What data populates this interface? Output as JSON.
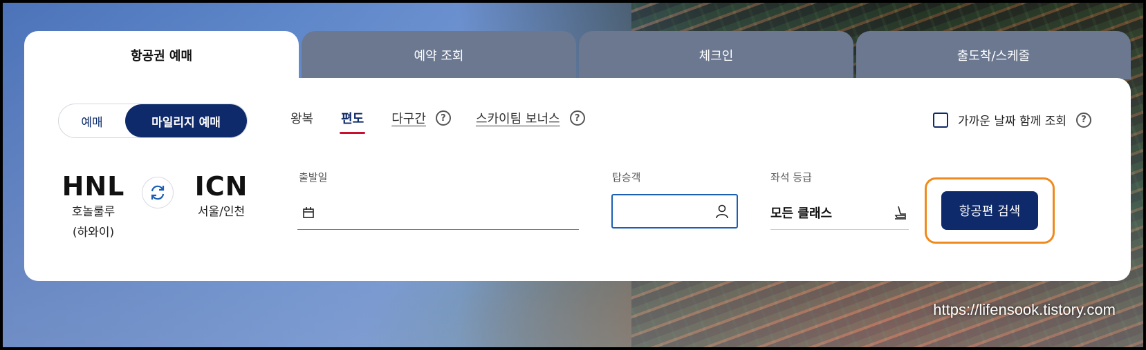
{
  "tabs": [
    {
      "label": "항공권 예매",
      "active": true
    },
    {
      "label": "예약 조회",
      "active": false
    },
    {
      "label": "체크인",
      "active": false
    },
    {
      "label": "출도착/스케줄",
      "active": false
    }
  ],
  "fare_toggle": {
    "normal": "예매",
    "mileage": "마일리지 예매",
    "selected": "마일리지 예매"
  },
  "trip_types": {
    "round": "왕복",
    "oneway": "편도",
    "multi": "다구간",
    "stopover": "스카이팀 보너스",
    "selected": "편도"
  },
  "flex_dates": {
    "label": "가까운 날짜 함께 조회",
    "checked": false
  },
  "origin": {
    "code": "HNL",
    "city_line1": "호놀룰루",
    "city_line2": "(하와이)"
  },
  "destination": {
    "code": "ICN",
    "city": "서울/인천"
  },
  "fields": {
    "depart_label": "출발일",
    "depart_value": "",
    "passengers_label": "탑승객",
    "passengers_value": "",
    "class_label": "좌석 등급",
    "class_value": "모든 클래스"
  },
  "search_button": "항공편 검색",
  "help_glyph": "?",
  "watermark": "https://lifensook.tistory.com",
  "colors": {
    "navy": "#0e2a6a",
    "accent_red": "#c8102e",
    "highlight_orange": "#f08a1c",
    "tab_inactive": "#6b7890"
  },
  "icons": [
    "calendar-icon",
    "person-icon",
    "seat-icon",
    "swap-icon",
    "help-icon"
  ]
}
